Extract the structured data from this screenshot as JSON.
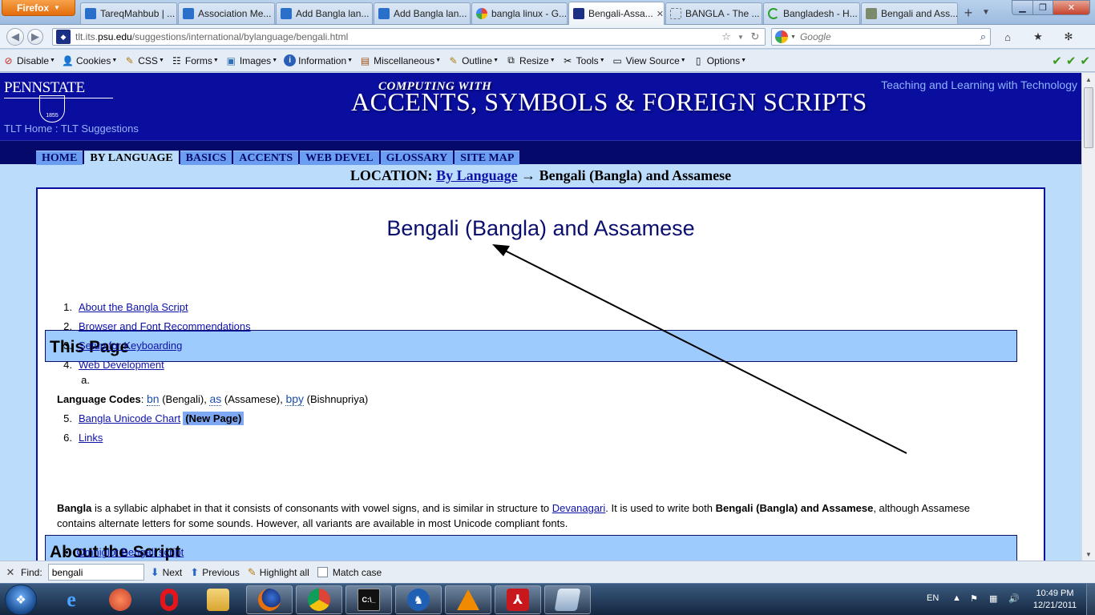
{
  "browser": {
    "app_button": "Firefox",
    "tabs": [
      {
        "label": "TareqMahbub | ..."
      },
      {
        "label": "Association Me..."
      },
      {
        "label": "Add Bangla lan..."
      },
      {
        "label": "Add Bangla lan..."
      },
      {
        "label": "bangla linux - G..."
      },
      {
        "label": "Bengali-Assa..."
      },
      {
        "label": "BANGLA - The ..."
      },
      {
        "label": "Bangladesh - H..."
      },
      {
        "label": "Bengali and Ass..."
      }
    ],
    "url_prefix": "tlt.its.",
    "url_domain": "psu.edu",
    "url_path": "/suggestions/international/bylanguage/bengali.html",
    "search_placeholder": "Google",
    "colors": {
      "accent": "#e46c0a",
      "page_blue": "#0a0e9e"
    }
  },
  "devtoolbar": {
    "items": [
      {
        "label": "Disable",
        "icon": "disable-icon"
      },
      {
        "label": "Cookies",
        "icon": "cookies-icon"
      },
      {
        "label": "CSS",
        "icon": "css-icon"
      },
      {
        "label": "Forms",
        "icon": "forms-icon"
      },
      {
        "label": "Images",
        "icon": "images-icon"
      },
      {
        "label": "Information",
        "icon": "information-icon"
      },
      {
        "label": "Miscellaneous",
        "icon": "miscellaneous-icon"
      },
      {
        "label": "Outline",
        "icon": "outline-icon"
      },
      {
        "label": "Resize",
        "icon": "resize-icon"
      },
      {
        "label": "Tools",
        "icon": "tools-icon"
      },
      {
        "label": "View Source",
        "icon": "view-source-icon"
      },
      {
        "label": "Options",
        "icon": "options-icon"
      }
    ]
  },
  "site": {
    "logo_word": "PENNSTATE",
    "logo_year": "1855",
    "crumb_home": "TLT Home",
    "crumb_sep": " : ",
    "crumb_suggestions": "TLT Suggestions",
    "banner_small": "COMPUTING WITH",
    "banner_big": "ACCENTS, SYMBOLS & FOREIGN SCRIPTS",
    "tagline": "Teaching and Learning with Technology",
    "menu": [
      "HOME",
      "BY LANGUAGE",
      "BASICS",
      "ACCENTS",
      "WEB DEVEL",
      "GLOSSARY",
      "SITE MAP"
    ],
    "location_label": "LOCATION:",
    "location_link": "By Language",
    "location_arrow": " → ",
    "location_current": "Bengali (Bangla) and Assamese"
  },
  "page": {
    "title": "Bengali (Bangla) and Assamese",
    "this_page_heading": "This Page",
    "toc": [
      {
        "num": "1.",
        "label": "About the Bangla Script"
      },
      {
        "num": "2.",
        "label": "Browser and Font Recommendations"
      },
      {
        "num": "3.",
        "label": "Setup for Keyboarding"
      },
      {
        "num": "4.",
        "label": "Web Development"
      },
      {
        "num": "a.",
        "label": ""
      },
      {
        "num": "5.",
        "label": "Bangla Unicode Chart"
      },
      {
        "num": "6.",
        "label": "Links"
      }
    ],
    "new_page_badge": "(New Page)",
    "lang_codes_label": "Language Codes",
    "lang_codes": [
      {
        "code": "bn",
        "name": "(Bengali)"
      },
      {
        "code": "as",
        "name": "(Assamese)"
      },
      {
        "code": "bpy",
        "name": "(Bishnupriya)"
      }
    ],
    "about_heading": "About the Script",
    "about_p1_bold": "Bangla",
    "about_p1_a": " is a syllabic alphabet in that it consists of consonants with vowel signs, and is similar in structure to ",
    "about_p1_link": "Devanagari",
    "about_p1_b": ". It is used to write both ",
    "about_p1_bold2": "Bengali (Bangla) and Assamese",
    "about_p1_c": ", although Assamese contains alternate letters for some sounds. However, all variants are available in most Unicode compliant fonts.",
    "omniglot_link": "Omniglot Bengali script"
  },
  "findbar": {
    "label": "Find:",
    "value": "bengali",
    "next": "Next",
    "previous": "Previous",
    "highlight": "Highlight all",
    "match_case": "Match case"
  },
  "taskbar": {
    "lang": "EN",
    "time": "10:49 PM",
    "date": "12/21/2011"
  }
}
